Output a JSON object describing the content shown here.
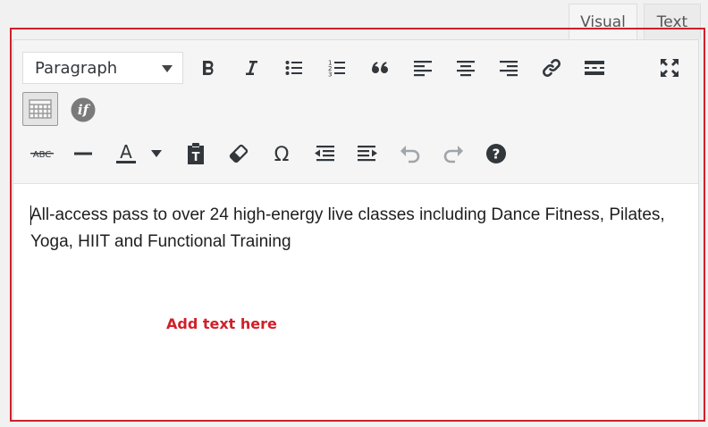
{
  "tabs": {
    "visual": "Visual",
    "text": "Text"
  },
  "toolbar": {
    "format_value": "Paragraph",
    "row1": [
      {
        "name": "bold-icon",
        "label": "Bold"
      },
      {
        "name": "italic-icon",
        "label": "Italic"
      },
      {
        "name": "bulleted-list-icon",
        "label": "Bulleted list"
      },
      {
        "name": "numbered-list-icon",
        "label": "Numbered list"
      },
      {
        "name": "blockquote-icon",
        "label": "Blockquote"
      },
      {
        "name": "align-left-icon",
        "label": "Align left"
      },
      {
        "name": "align-center-icon",
        "label": "Align center"
      },
      {
        "name": "align-right-icon",
        "label": "Align right"
      },
      {
        "name": "link-icon",
        "label": "Insert/edit link"
      },
      {
        "name": "read-more-icon",
        "label": "Insert Read More tag"
      },
      {
        "name": "fullscreen-icon",
        "label": "Fullscreen"
      }
    ],
    "row2": [
      {
        "name": "toolbar-toggle-icon",
        "label": "Toolbar Toggle",
        "pressed": true
      },
      {
        "name": "conditional-if-icon",
        "label": "if"
      }
    ],
    "row3": [
      {
        "name": "strikethrough-icon",
        "label": "ABC"
      },
      {
        "name": "horizontal-line-icon",
        "label": "Horizontal line"
      },
      {
        "name": "text-color-icon",
        "label": "A"
      },
      {
        "name": "paste-as-text-icon",
        "label": "Paste as text"
      },
      {
        "name": "clear-formatting-icon",
        "label": "Clear formatting"
      },
      {
        "name": "special-character-icon",
        "label": "Ω"
      },
      {
        "name": "decrease-indent-icon",
        "label": "Decrease indent"
      },
      {
        "name": "increase-indent-icon",
        "label": "Increase indent"
      },
      {
        "name": "undo-icon",
        "label": "Undo"
      },
      {
        "name": "redo-icon",
        "label": "Redo"
      },
      {
        "name": "help-icon",
        "label": "?"
      }
    ]
  },
  "content": {
    "paragraph": "All-access pass to over 24 high-energy live classes including Dance Fitness, Pilates, Yoga, HIIT and Functional Training"
  },
  "annotation": {
    "text": "Add text here",
    "color": "#d0202a"
  },
  "colors": {
    "highlight_border": "#d0202a",
    "icon": "#32373c",
    "icon_disabled": "#a0a5aa",
    "toolbar_bg": "#f5f5f5"
  }
}
